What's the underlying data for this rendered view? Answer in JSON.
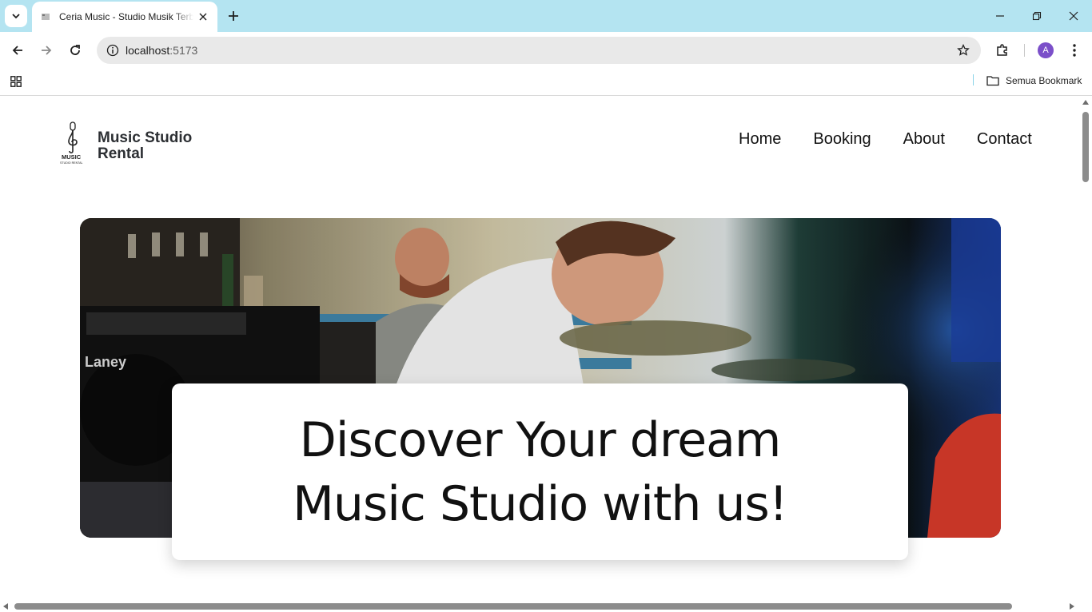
{
  "browser": {
    "tab_title": "Ceria Music - Studio Musik Terbaik",
    "url_host": "localhost",
    "url_port": ":5173",
    "bookmarks_all_label": "Semua Bookmark",
    "profile_initial": "A",
    "colors": {
      "tabbar": "#b4e4f1",
      "profile": "#7b4fc9"
    }
  },
  "site": {
    "logo": {
      "line1": "Music Studio",
      "line2": "Rental",
      "mark_text": "MUSIC",
      "mark_subtext": "STUDIO RENTAL"
    },
    "nav": [
      {
        "label": "Home"
      },
      {
        "label": "Booking"
      },
      {
        "label": "About"
      },
      {
        "label": "Contact"
      }
    ],
    "hero": {
      "headline_line1": "Discover Your dream",
      "headline_line2": "Music Studio with us!",
      "amp_brand": "Laney"
    }
  }
}
